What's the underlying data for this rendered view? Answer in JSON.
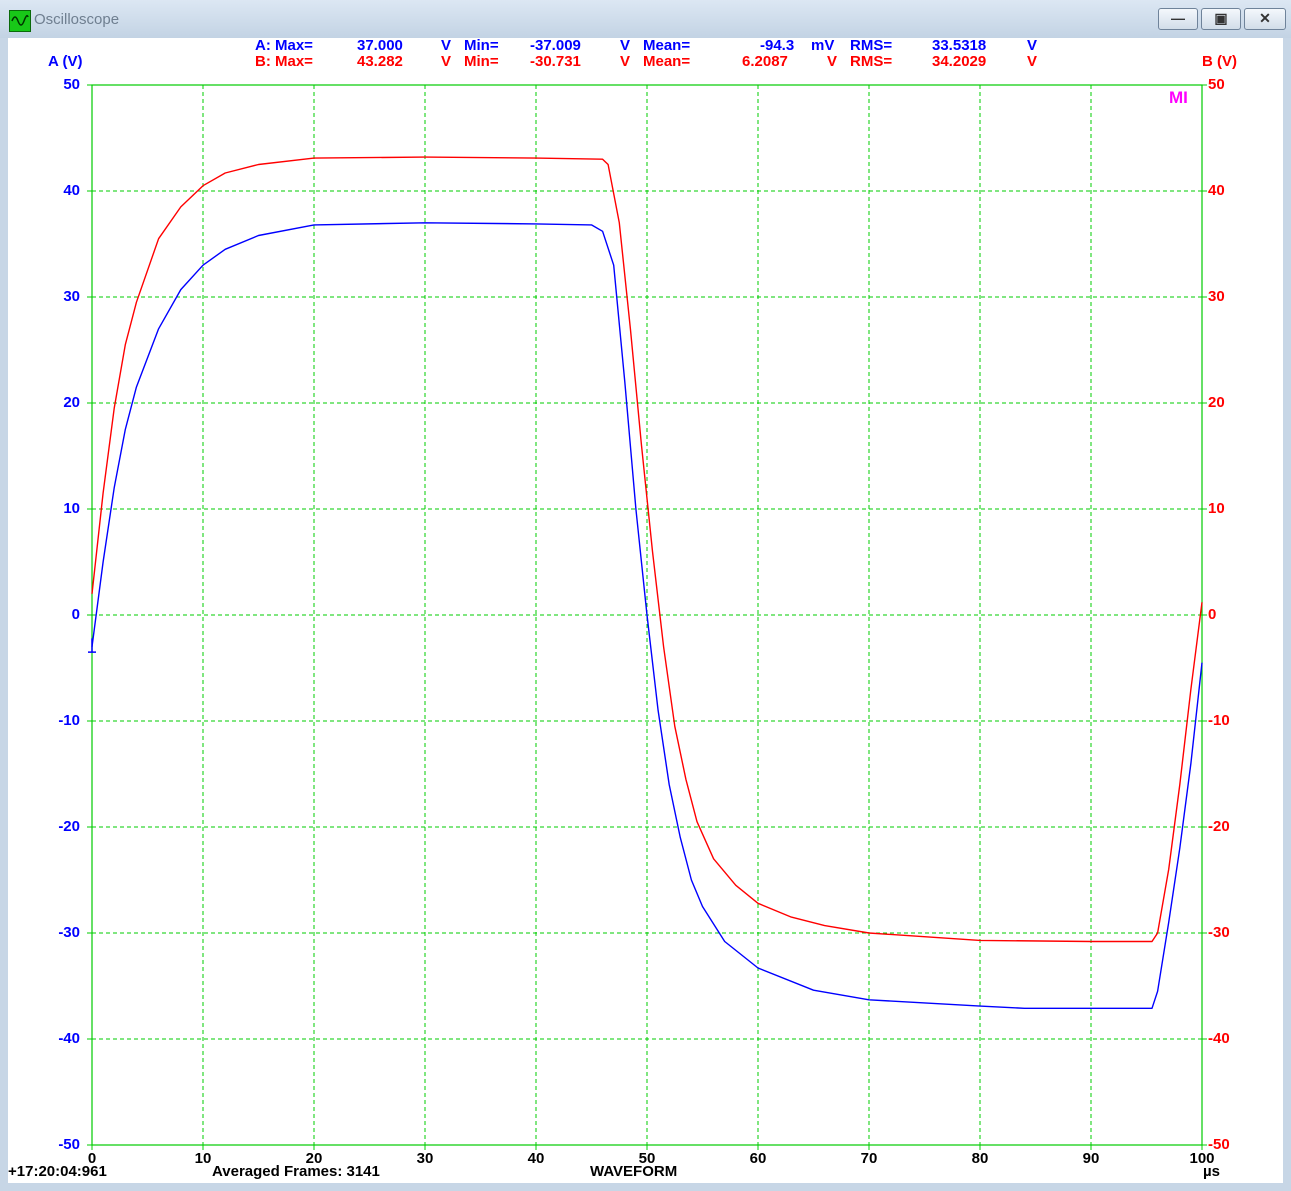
{
  "window": {
    "title": "Oscilloscope",
    "buttons": {
      "minimize": "—",
      "maximize": "▣",
      "close": "✕"
    }
  },
  "stats": {
    "a": {
      "label": "A: Max=",
      "max": "37.000",
      "max_unit": "V",
      "min_label": "Min=",
      "min": "-37.009",
      "min_unit": "V",
      "mean_label": "Mean=",
      "mean": "-94.3",
      "mean_unit": "mV",
      "rms_label": "RMS=",
      "rms": "33.5318",
      "rms_unit": "V"
    },
    "b": {
      "label": "B: Max=",
      "max": "43.282",
      "max_unit": "V",
      "min_label": "Min=",
      "min": "-30.731",
      "min_unit": "V",
      "mean_label": "Mean=",
      "mean": "6.2087",
      "mean_unit": "V",
      "rms_label": "RMS=",
      "rms": "34.2029",
      "rms_unit": "V"
    }
  },
  "marker_label": "MI",
  "footer": {
    "timestamp": "+17:20:04:961",
    "frames": "Averaged Frames: 3141",
    "mode": "WAVEFORM"
  },
  "colors": {
    "channel_a": "#0000ff",
    "channel_b": "#ff0000",
    "grid": "#00cc00",
    "marker": "#ff00ff"
  },
  "chart_data": {
    "type": "line",
    "ylabel_left": "A (V)",
    "ylabel_right": "B (V)",
    "xlabel": "µs",
    "xlim": [
      0,
      100
    ],
    "ylim": [
      -50,
      50
    ],
    "x_ticks": [
      "0",
      "10",
      "20",
      "30",
      "40",
      "50",
      "60",
      "70",
      "80",
      "90",
      "100"
    ],
    "y_ticks": [
      "50",
      "40",
      "30",
      "20",
      "10",
      "0",
      "-10",
      "-20",
      "-30",
      "-40",
      "-50"
    ],
    "grid": true,
    "series": [
      {
        "name": "A",
        "axis": "left",
        "x": [
          0,
          1,
          2,
          3,
          4,
          6,
          8,
          10,
          12,
          15,
          20,
          30,
          40,
          45,
          46,
          47,
          48,
          49,
          50,
          51,
          52,
          53,
          54,
          55,
          57,
          60,
          65,
          70,
          80,
          84,
          90,
          95.5,
          96,
          97,
          98,
          99,
          100
        ],
        "y": [
          -3,
          5,
          12,
          17.5,
          21.5,
          27,
          30.7,
          33,
          34.5,
          35.8,
          36.8,
          37,
          36.9,
          36.8,
          36.2,
          33,
          22,
          10,
          0,
          -9,
          -16,
          -21,
          -25,
          -27.5,
          -30.8,
          -33.3,
          -35.4,
          -36.3,
          -36.9,
          -37.1,
          -37.1,
          -37.1,
          -35.5,
          -29,
          -22,
          -14,
          -4.5
        ]
      },
      {
        "name": "B",
        "axis": "left",
        "x": [
          0,
          1,
          2,
          3,
          4,
          6,
          8,
          10,
          12,
          15,
          20,
          30,
          40,
          46,
          46.5,
          47.5,
          48.5,
          49.5,
          50.5,
          51.5,
          52.5,
          53.5,
          54.5,
          56,
          58,
          60,
          63,
          66,
          70,
          80,
          90,
          95.5,
          96,
          97,
          98,
          99,
          100
        ],
        "y": [
          2,
          11.5,
          19.5,
          25.5,
          29.5,
          35.5,
          38.5,
          40.5,
          41.7,
          42.5,
          43.1,
          43.2,
          43.1,
          43,
          42.5,
          37,
          27,
          16,
          6,
          -3,
          -10.5,
          -15.5,
          -19.5,
          -23,
          -25.5,
          -27.2,
          -28.5,
          -29.3,
          -30,
          -30.7,
          -30.8,
          -30.8,
          -30,
          -24,
          -16,
          -7,
          1.2
        ]
      }
    ]
  }
}
